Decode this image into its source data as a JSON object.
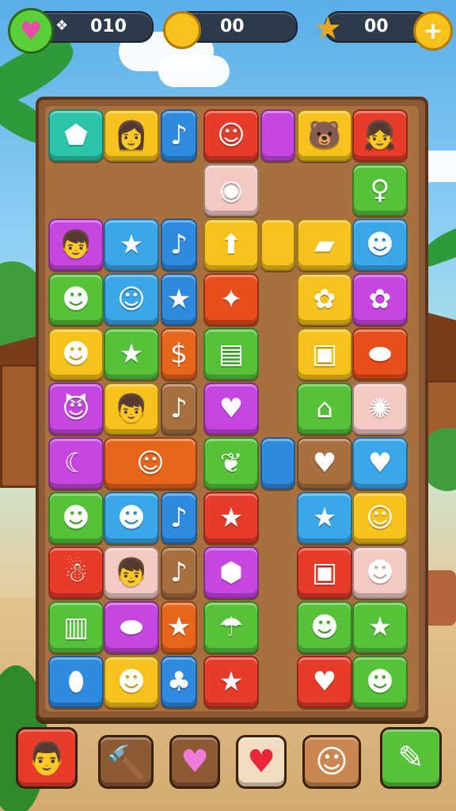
{
  "hud": {
    "lives_value": "010",
    "coins_value": "00",
    "stars_value": "00",
    "lives_icon": "heart-icon",
    "coin_icon": "coin-icon",
    "star_icon": "star-icon",
    "add_icon": "plus-icon"
  },
  "board": {
    "tiles": [
      {
        "col": 0,
        "row": 0,
        "color": "#2bc4a8",
        "glyph": "⬟"
      },
      {
        "col": 1,
        "row": 0,
        "color": "#f7c21c",
        "glyph": "👩"
      },
      {
        "col": 2,
        "row": 0,
        "color": "#2f8be0",
        "glyph": "♪",
        "narrow": true
      },
      {
        "col": 3,
        "row": 0,
        "color": "#e73c2a",
        "glyph": "☺"
      },
      {
        "col": 4,
        "row": 0,
        "color": "#c746e0",
        "glyph": "",
        "narrow": true
      },
      {
        "col": 5,
        "row": 0,
        "color": "#f7c21c",
        "glyph": "🐻"
      },
      {
        "col": 6,
        "row": 0,
        "color": "#e73c2a",
        "glyph": "👧"
      },
      {
        "col": 3,
        "row": 1,
        "color": "#f4c9c4",
        "glyph": "◉"
      },
      {
        "col": 6,
        "row": 1,
        "color": "#55c23a",
        "glyph": "♀"
      },
      {
        "col": 0,
        "row": 2,
        "color": "#c746e0",
        "glyph": "👦"
      },
      {
        "col": 1,
        "row": 2,
        "color": "#3aa7e8",
        "glyph": "★"
      },
      {
        "col": 2,
        "row": 2,
        "color": "#2f8be0",
        "glyph": "♪",
        "narrow": true
      },
      {
        "col": 3,
        "row": 2,
        "color": "#f7c21c",
        "glyph": "⬆"
      },
      {
        "col": 4,
        "row": 2,
        "color": "#f7c21c",
        "glyph": "",
        "narrow": true
      },
      {
        "col": 5,
        "row": 2,
        "color": "#f7c21c",
        "glyph": "▰"
      },
      {
        "col": 6,
        "row": 2,
        "color": "#3aa7e8",
        "glyph": "☻"
      },
      {
        "col": 0,
        "row": 3,
        "color": "#55c23a",
        "glyph": "☻"
      },
      {
        "col": 1,
        "row": 3,
        "color": "#3aa7e8",
        "glyph": "☺"
      },
      {
        "col": 2,
        "row": 3,
        "color": "#2f8be0",
        "glyph": "★",
        "narrow": true
      },
      {
        "col": 3,
        "row": 3,
        "color": "#e84e1c",
        "glyph": "✦"
      },
      {
        "col": 5,
        "row": 3,
        "color": "#f7c21c",
        "glyph": "✿"
      },
      {
        "col": 6,
        "row": 3,
        "color": "#c746e0",
        "glyph": "✿"
      },
      {
        "col": 0,
        "row": 4,
        "color": "#f7c21c",
        "glyph": "☻"
      },
      {
        "col": 1,
        "row": 4,
        "color": "#55c23a",
        "glyph": "★"
      },
      {
        "col": 2,
        "row": 4,
        "color": "#e8651c",
        "glyph": "$",
        "narrow": true
      },
      {
        "col": 3,
        "row": 4,
        "color": "#55c23a",
        "glyph": "▤"
      },
      {
        "col": 5,
        "row": 4,
        "color": "#f7c21c",
        "glyph": "▣"
      },
      {
        "col": 6,
        "row": 4,
        "color": "#e84e1c",
        "glyph": "⬬"
      },
      {
        "col": 0,
        "row": 5,
        "color": "#c746e0",
        "glyph": "😈"
      },
      {
        "col": 1,
        "row": 5,
        "color": "#f7c21c",
        "glyph": "👦"
      },
      {
        "col": 2,
        "row": 5,
        "color": "#a8703f",
        "glyph": "♪",
        "narrow": true
      },
      {
        "col": 3,
        "row": 5,
        "color": "#c746e0",
        "glyph": "♥"
      },
      {
        "col": 5,
        "row": 5,
        "color": "#55c23a",
        "glyph": "⌂"
      },
      {
        "col": 6,
        "row": 5,
        "color": "#f4c9c4",
        "glyph": "✺"
      },
      {
        "col": 0,
        "row": 6,
        "color": "#c746e0",
        "glyph": "☾"
      },
      {
        "col": 1,
        "row": 6,
        "color": "#e8651c",
        "glyph": "☺",
        "wide": true
      },
      {
        "col": 3,
        "row": 6,
        "color": "#55c23a",
        "glyph": "❦"
      },
      {
        "col": 4,
        "row": 6,
        "color": "#2f8be0",
        "glyph": "",
        "narrow": true
      },
      {
        "col": 5,
        "row": 6,
        "color": "#a8703f",
        "glyph": "♥"
      },
      {
        "col": 6,
        "row": 6,
        "color": "#3aa7e8",
        "glyph": "♥"
      },
      {
        "col": 0,
        "row": 7,
        "color": "#55c23a",
        "glyph": "☻"
      },
      {
        "col": 1,
        "row": 7,
        "color": "#3aa7e8",
        "glyph": "☻"
      },
      {
        "col": 2,
        "row": 7,
        "color": "#2f8be0",
        "glyph": "♪",
        "narrow": true
      },
      {
        "col": 3,
        "row": 7,
        "color": "#e73c2a",
        "glyph": "★"
      },
      {
        "col": 5,
        "row": 7,
        "color": "#3aa7e8",
        "glyph": "★"
      },
      {
        "col": 6,
        "row": 7,
        "color": "#f7c21c",
        "glyph": "☺"
      },
      {
        "col": 0,
        "row": 8,
        "color": "#e73c2a",
        "glyph": "☃"
      },
      {
        "col": 1,
        "row": 8,
        "color": "#f4c9c4",
        "glyph": "👦"
      },
      {
        "col": 2,
        "row": 8,
        "color": "#a8703f",
        "glyph": "♪",
        "narrow": true
      },
      {
        "col": 3,
        "row": 8,
        "color": "#c746e0",
        "glyph": "⬢"
      },
      {
        "col": 5,
        "row": 8,
        "color": "#e73c2a",
        "glyph": "▣"
      },
      {
        "col": 6,
        "row": 8,
        "color": "#f4c9c4",
        "glyph": "☻"
      },
      {
        "col": 0,
        "row": 9,
        "color": "#55c23a",
        "glyph": "▥"
      },
      {
        "col": 1,
        "row": 9,
        "color": "#c746e0",
        "glyph": "⬬"
      },
      {
        "col": 2,
        "row": 9,
        "color": "#e8651c",
        "glyph": "★",
        "narrow": true
      },
      {
        "col": 3,
        "row": 9,
        "color": "#55c23a",
        "glyph": "☂"
      },
      {
        "col": 5,
        "row": 9,
        "color": "#55c23a",
        "glyph": "☻"
      },
      {
        "col": 6,
        "row": 9,
        "color": "#55c23a",
        "glyph": "★"
      },
      {
        "col": 0,
        "row": 10,
        "color": "#2f8be0",
        "glyph": "⬮"
      },
      {
        "col": 1,
        "row": 10,
        "color": "#f7c21c",
        "glyph": "☻"
      },
      {
        "col": 2,
        "row": 10,
        "color": "#2f8be0",
        "glyph": "♣",
        "narrow": true
      },
      {
        "col": 3,
        "row": 10,
        "color": "#e73c2a",
        "glyph": "★"
      },
      {
        "col": 5,
        "row": 10,
        "color": "#e73c2a",
        "glyph": "♥"
      },
      {
        "col": 6,
        "row": 10,
        "color": "#55c23a",
        "glyph": "☻"
      }
    ]
  },
  "toolbar": {
    "items": [
      {
        "name": "avatar",
        "color": "#e73c2a",
        "glyph": "👨"
      },
      {
        "name": "hammer-booster",
        "color": "#8d5a36",
        "glyph": "🔨"
      },
      {
        "name": "heart-booster-pink",
        "color": "#8d5a36",
        "glyph": "♥"
      },
      {
        "name": "heart-booster-red",
        "color": "#f0dcc0",
        "glyph": "♥"
      },
      {
        "name": "smiley-booster",
        "color": "#c9864e",
        "glyph": "☺"
      },
      {
        "name": "pencil-booster",
        "color": "#55c23a",
        "glyph": "✎"
      }
    ]
  }
}
